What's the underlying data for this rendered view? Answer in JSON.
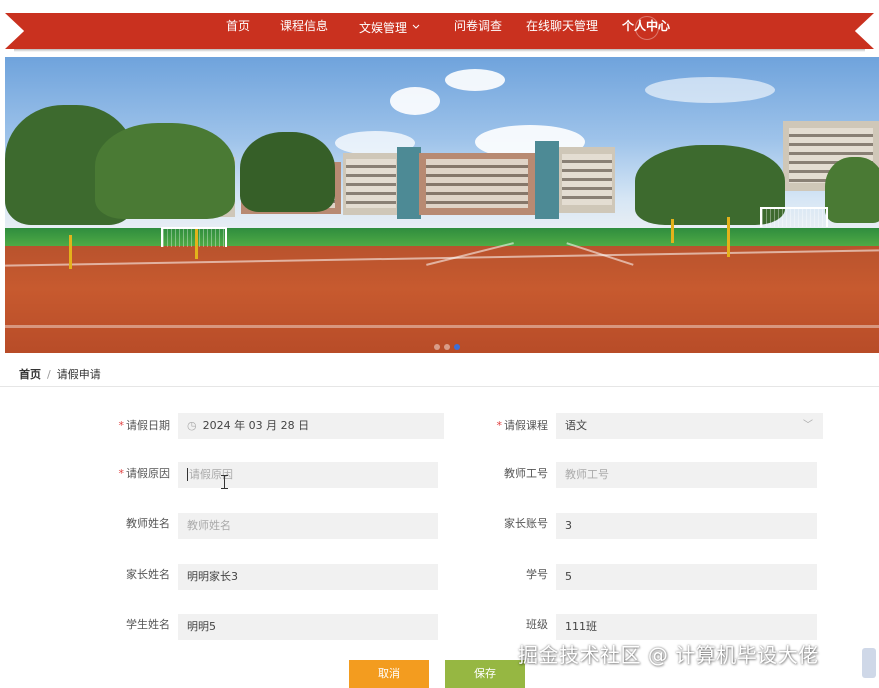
{
  "nav": {
    "items": [
      {
        "label": "首页"
      },
      {
        "label": "课程信息"
      },
      {
        "label": "文娱管理"
      },
      {
        "label": "问卷调查"
      },
      {
        "label": "在线聊天管理"
      },
      {
        "label": "个人中心"
      }
    ],
    "active_index": 5,
    "dropdown_item": "文娱管理",
    "colors": {
      "ribbon": "#c9311f",
      "text": "#ffffff"
    }
  },
  "banner": {
    "slide_count": 3,
    "active_slide": 3,
    "description_icon": "school-playground-photo"
  },
  "breadcrumb": {
    "home": "首页",
    "separator": "/",
    "current": "请假申请"
  },
  "form": {
    "leave_date": {
      "label": "请假日期",
      "required": true,
      "value": "2024 年 03 月 28 日",
      "icon": "clock-icon"
    },
    "leave_course": {
      "label": "请假课程",
      "required": true,
      "value": "语文"
    },
    "leave_reason": {
      "label": "请假原因",
      "required": true,
      "placeholder": "请假原因",
      "value": ""
    },
    "teacher_id": {
      "label": "教师工号",
      "placeholder": "教师工号",
      "value": ""
    },
    "teacher_name": {
      "label": "教师姓名",
      "placeholder": "教师姓名",
      "value": ""
    },
    "parent_account": {
      "label": "家长账号",
      "value": "3"
    },
    "parent_name": {
      "label": "家长姓名",
      "value": "明明家长3"
    },
    "student_id": {
      "label": "学号",
      "value": "5"
    },
    "student_name": {
      "label": "学生姓名",
      "value": "明明5"
    },
    "class_name": {
      "label": "班级",
      "value": "111班"
    }
  },
  "buttons": {
    "cancel": "取消",
    "save": "保存"
  },
  "colors": {
    "cancel": "#f39c1f",
    "save": "#96b742",
    "required": "#e04040",
    "field_bg": "#f1f1f1"
  },
  "watermark": "掘金技术社区 @ 计算机毕设大佬"
}
